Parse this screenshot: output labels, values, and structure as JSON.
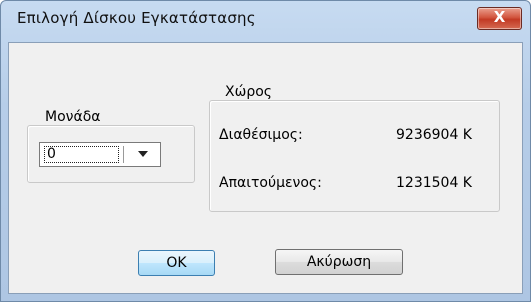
{
  "window": {
    "title": "Επιλογή Δίσκου Εγκατάστασης",
    "close_label": "X"
  },
  "drive_group": {
    "label": "Μονάδα",
    "selected_value": "0"
  },
  "space_group": {
    "label": "Χώρος",
    "available_label": "Διαθέσιμος:",
    "available_value": "9236904 K",
    "required_label": "Απαιτούμενος:",
    "required_value": "1231504 K"
  },
  "buttons": {
    "ok_label": "OK",
    "cancel_label": "Ακύρωση"
  },
  "icons": {
    "close": "close-icon",
    "dropdown": "chevron-down-icon"
  }
}
